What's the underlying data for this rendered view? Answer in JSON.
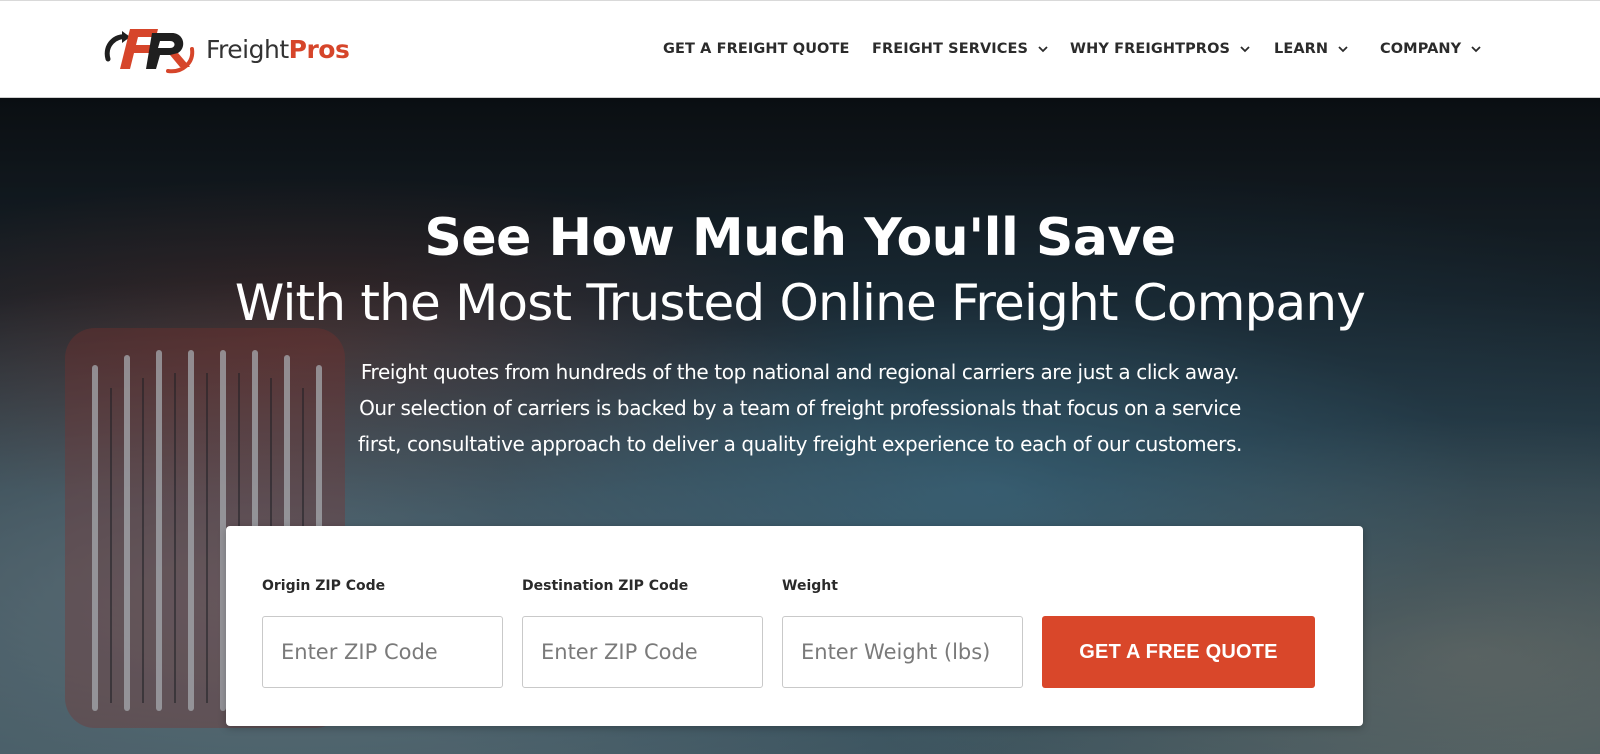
{
  "brand": {
    "name_part1": "Freight",
    "name_part2": "Pros",
    "logo_icon": "fp-logo-icon",
    "accent_color": "#d9472a"
  },
  "nav": {
    "items": [
      {
        "label": "GET A FREIGHT QUOTE",
        "has_dropdown": false
      },
      {
        "label": "FREIGHT SERVICES",
        "has_dropdown": true,
        "icon": "chevron-down-icon"
      },
      {
        "label": "WHY FREIGHTPROS",
        "has_dropdown": true,
        "icon": "chevron-down-icon"
      },
      {
        "label": "LEARN",
        "has_dropdown": true,
        "icon": "chevron-down-icon"
      },
      {
        "label": "COMPANY",
        "has_dropdown": true,
        "icon": "chevron-down-icon"
      }
    ]
  },
  "hero": {
    "title": "See How Much You'll Save",
    "subtitle": "With the Most Trusted Online Freight Company",
    "description_lines": [
      "Freight quotes from hundreds of the top national and regional carriers are just a click away.",
      "Our selection of carriers is backed by a team of freight professionals that focus on a service",
      "first, consultative approach to deliver a quality freight experience to each of our customers."
    ]
  },
  "quote_form": {
    "origin": {
      "label": "Origin ZIP Code",
      "placeholder": "Enter ZIP Code",
      "value": ""
    },
    "destination": {
      "label": "Destination ZIP Code",
      "placeholder": "Enter ZIP Code",
      "value": ""
    },
    "weight": {
      "label": "Weight",
      "placeholder": "Enter Weight (lbs)",
      "value": ""
    },
    "submit_label": "GET A FREE QUOTE"
  }
}
